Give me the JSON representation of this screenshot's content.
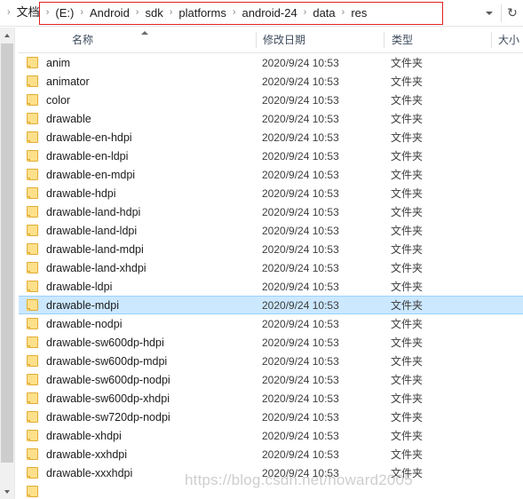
{
  "address_bar": {
    "leading_separator": "›",
    "crumbs": [
      {
        "label": "文档",
        "cjk": true
      },
      {
        "label": "(E:)",
        "cjk": false
      },
      {
        "label": "Android",
        "cjk": false
      },
      {
        "label": "sdk",
        "cjk": false
      },
      {
        "label": "platforms",
        "cjk": false
      },
      {
        "label": "android-24",
        "cjk": false
      },
      {
        "label": "data",
        "cjk": false
      },
      {
        "label": "res",
        "cjk": false
      }
    ],
    "separator": "›",
    "dropdown_icon": "chevron-down-icon",
    "refresh_icon": "refresh-icon",
    "refresh_glyph": "↻",
    "annotation_color": "#e02020"
  },
  "columns": {
    "name": "名称",
    "date_modified": "修改日期",
    "type": "类型",
    "size": "大小",
    "sort_column": "名称",
    "sort_direction": "ascending"
  },
  "scrollbar": {
    "up_arrow": "scroll-up-arrow",
    "down_arrow": "scroll-down-arrow",
    "orientation": "vertical",
    "position": "left"
  },
  "files": [
    {
      "name": "anim",
      "date": "2020/9/24 10:53",
      "type": "文件夹",
      "size": "",
      "selected": false
    },
    {
      "name": "animator",
      "date": "2020/9/24 10:53",
      "type": "文件夹",
      "size": "",
      "selected": false
    },
    {
      "name": "color",
      "date": "2020/9/24 10:53",
      "type": "文件夹",
      "size": "",
      "selected": false
    },
    {
      "name": "drawable",
      "date": "2020/9/24 10:53",
      "type": "文件夹",
      "size": "",
      "selected": false
    },
    {
      "name": "drawable-en-hdpi",
      "date": "2020/9/24 10:53",
      "type": "文件夹",
      "size": "",
      "selected": false
    },
    {
      "name": "drawable-en-ldpi",
      "date": "2020/9/24 10:53",
      "type": "文件夹",
      "size": "",
      "selected": false
    },
    {
      "name": "drawable-en-mdpi",
      "date": "2020/9/24 10:53",
      "type": "文件夹",
      "size": "",
      "selected": false
    },
    {
      "name": "drawable-hdpi",
      "date": "2020/9/24 10:53",
      "type": "文件夹",
      "size": "",
      "selected": false
    },
    {
      "name": "drawable-land-hdpi",
      "date": "2020/9/24 10:53",
      "type": "文件夹",
      "size": "",
      "selected": false
    },
    {
      "name": "drawable-land-ldpi",
      "date": "2020/9/24 10:53",
      "type": "文件夹",
      "size": "",
      "selected": false
    },
    {
      "name": "drawable-land-mdpi",
      "date": "2020/9/24 10:53",
      "type": "文件夹",
      "size": "",
      "selected": false
    },
    {
      "name": "drawable-land-xhdpi",
      "date": "2020/9/24 10:53",
      "type": "文件夹",
      "size": "",
      "selected": false
    },
    {
      "name": "drawable-ldpi",
      "date": "2020/9/24 10:53",
      "type": "文件夹",
      "size": "",
      "selected": false
    },
    {
      "name": "drawable-mdpi",
      "date": "2020/9/24 10:53",
      "type": "文件夹",
      "size": "",
      "selected": true
    },
    {
      "name": "drawable-nodpi",
      "date": "2020/9/24 10:53",
      "type": "文件夹",
      "size": "",
      "selected": false
    },
    {
      "name": "drawable-sw600dp-hdpi",
      "date": "2020/9/24 10:53",
      "type": "文件夹",
      "size": "",
      "selected": false
    },
    {
      "name": "drawable-sw600dp-mdpi",
      "date": "2020/9/24 10:53",
      "type": "文件夹",
      "size": "",
      "selected": false
    },
    {
      "name": "drawable-sw600dp-nodpi",
      "date": "2020/9/24 10:53",
      "type": "文件夹",
      "size": "",
      "selected": false
    },
    {
      "name": "drawable-sw600dp-xhdpi",
      "date": "2020/9/24 10:53",
      "type": "文件夹",
      "size": "",
      "selected": false
    },
    {
      "name": "drawable-sw720dp-nodpi",
      "date": "2020/9/24 10:53",
      "type": "文件夹",
      "size": "",
      "selected": false
    },
    {
      "name": "drawable-xhdpi",
      "date": "2020/9/24 10:53",
      "type": "文件夹",
      "size": "",
      "selected": false
    },
    {
      "name": "drawable-xxhdpi",
      "date": "2020/9/24 10:53",
      "type": "文件夹",
      "size": "",
      "selected": false
    },
    {
      "name": "drawable-xxxhdpi",
      "date": "2020/9/24 10:53",
      "type": "文件夹",
      "size": "",
      "selected": false
    },
    {
      "name": "",
      "date": "",
      "type": "",
      "size": "",
      "selected": false
    }
  ],
  "watermark": {
    "text": "https://blog.csdn.net/howard2005"
  }
}
